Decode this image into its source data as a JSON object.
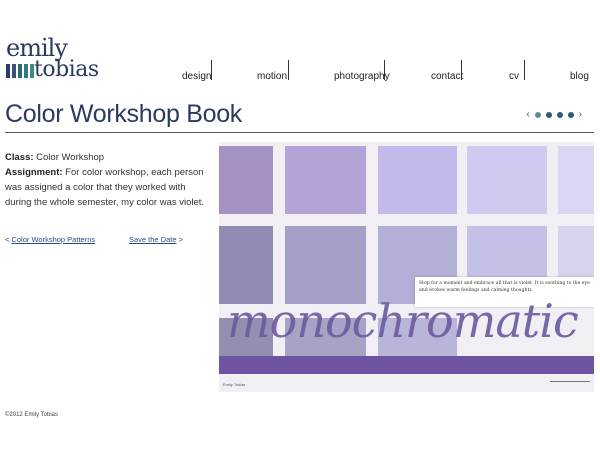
{
  "logo": {
    "line1": "emily",
    "line2": "tobias",
    "bar_colors": [
      "#2e3a67",
      "#3b4f7a",
      "#2c6a72",
      "#357b7a",
      "#3d8a7e"
    ]
  },
  "nav": {
    "items": [
      "design",
      "motion",
      "photography",
      "contact",
      "cv",
      "blog"
    ]
  },
  "page": {
    "title": "Color Workshop Book"
  },
  "slider": {
    "prev": "‹",
    "next": "›",
    "dot_count": 4
  },
  "info": {
    "class_label": "Class:",
    "class_value": " Color Workshop",
    "assignment_label": "Assignment:",
    "assignment_value": " For color workshop, each person was assigned a color that they worked with during the whole semester, my color was violet."
  },
  "pager": {
    "prev_arrow": "< ",
    "prev_label": "Color Workshop Patterns",
    "next_label": "Save the Date",
    "next_arrow": " >"
  },
  "artwork": {
    "caption": "Stop for a moment and embrace all that is violet. It is soothing to the eye and evokes warm feelings and calming thoughts.",
    "word": "monochromatic",
    "credit": "Emily Tobias"
  },
  "footer": {
    "text": "©2012 Emily Tobias"
  },
  "colors": {
    "accent": "#2c3a62",
    "violet": "#6e54a3"
  }
}
